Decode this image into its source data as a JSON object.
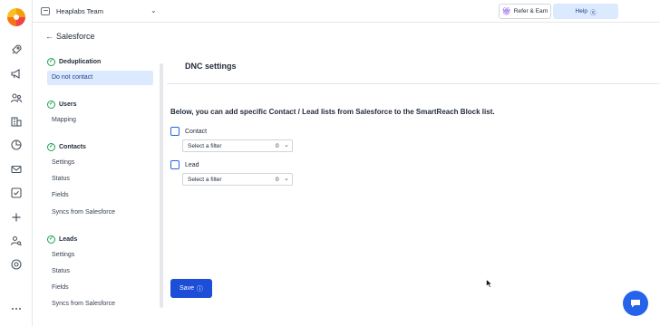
{
  "rail": {
    "icons": [
      "rocket-icon",
      "megaphone-icon",
      "users-icon",
      "building-icon",
      "pie-chart-icon",
      "mail-icon",
      "check-square-icon",
      "plus-icon",
      "user-search-icon",
      "settings-icon",
      "more-icon"
    ]
  },
  "topbar": {
    "team_name": "Heaplabs Team",
    "refer_label": "Refer & Earn",
    "help_label": "Help"
  },
  "page": {
    "back_arrow": "←",
    "title": "Salesforce"
  },
  "sidebar": {
    "sections": [
      {
        "heading": "Deduplication",
        "items": [
          "Do not contact"
        ]
      },
      {
        "heading": "Users",
        "items": [
          "Mapping"
        ]
      },
      {
        "heading": "Contacts",
        "items": [
          "Settings",
          "Status",
          "Fields",
          "Syncs from Salesforce"
        ]
      },
      {
        "heading": "Leads",
        "items": [
          "Settings",
          "Status",
          "Fields",
          "Syncs from Salesforce"
        ]
      }
    ],
    "active_item": "Do not contact"
  },
  "main": {
    "title": "DNC settings",
    "description": "Below, you can add specific Contact / Lead lists from Salesforce to the SmartReach Block list.",
    "lists": [
      {
        "label": "Contact",
        "filter_placeholder": "Select a filter",
        "count": "0",
        "checked": false
      },
      {
        "label": "Lead",
        "filter_placeholder": "Select a filter",
        "count": "0",
        "checked": false
      }
    ],
    "save_label": "Save"
  },
  "colors": {
    "accent": "#1d4ed8",
    "active_bg": "#dbeafe",
    "check_green": "#16a34a"
  }
}
